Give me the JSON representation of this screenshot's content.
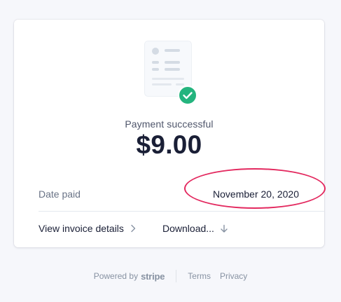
{
  "payment": {
    "status": "Payment successful",
    "amount": "$9.00"
  },
  "details": {
    "date_label": "Date paid",
    "date_value": "November 20, 2020"
  },
  "actions": {
    "invoice_label": "View invoice details",
    "invoice_icon": "chevron-right-icon",
    "download_label": "Download...",
    "download_icon": "arrow-down-icon"
  },
  "footer": {
    "powered_by": "Powered by",
    "brand": "stripe",
    "terms": "Terms",
    "privacy": "Privacy"
  },
  "colors": {
    "success": "#24b47e",
    "highlight": "#e3295f",
    "background": "#f6f7fb"
  },
  "icons": {
    "receipt": "receipt-icon",
    "success": "checkmark-circle-icon"
  }
}
